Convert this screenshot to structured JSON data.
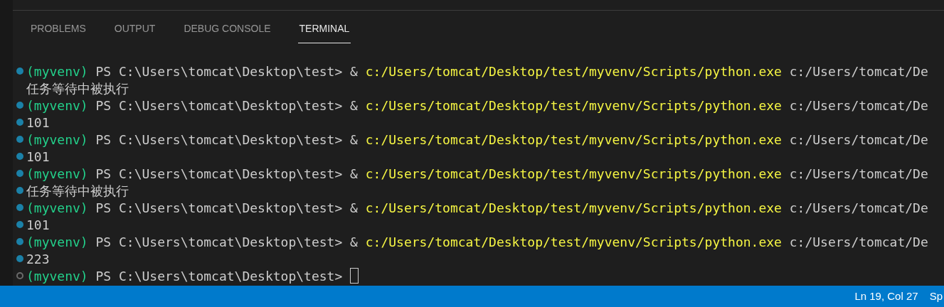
{
  "tabs": [
    {
      "label": "PROBLEMS",
      "selected": false
    },
    {
      "label": "OUTPUT",
      "selected": false
    },
    {
      "label": "DEBUG CONSOLE",
      "selected": false
    },
    {
      "label": "TERMINAL",
      "selected": true
    }
  ],
  "terminal_lines": [
    {
      "kind": "command",
      "decorated": true,
      "completed": true,
      "env": "(myvenv)",
      "prompt": "PS C:\\Users\\tomcat\\Desktop\\test>",
      "operator": "&",
      "program": "c:/Users/tomcat/Desktop/test/myvenv/Scripts/python.exe",
      "argument": "c:/Users/tomcat/De"
    },
    {
      "kind": "output",
      "decorated": false,
      "text": "任务等待中被执行"
    },
    {
      "kind": "command",
      "decorated": true,
      "completed": true,
      "env": "(myvenv)",
      "prompt": "PS C:\\Users\\tomcat\\Desktop\\test>",
      "operator": "&",
      "program": "c:/Users/tomcat/Desktop/test/myvenv/Scripts/python.exe",
      "argument": "c:/Users/tomcat/De"
    },
    {
      "kind": "output",
      "decorated": true,
      "completed": true,
      "text": "101"
    },
    {
      "kind": "command",
      "decorated": true,
      "completed": true,
      "env": "(myvenv)",
      "prompt": "PS C:\\Users\\tomcat\\Desktop\\test>",
      "operator": "&",
      "program": "c:/Users/tomcat/Desktop/test/myvenv/Scripts/python.exe",
      "argument": "c:/Users/tomcat/De"
    },
    {
      "kind": "output",
      "decorated": true,
      "completed": true,
      "text": "101"
    },
    {
      "kind": "command",
      "decorated": true,
      "completed": true,
      "env": "(myvenv)",
      "prompt": "PS C:\\Users\\tomcat\\Desktop\\test>",
      "operator": "&",
      "program": "c:/Users/tomcat/Desktop/test/myvenv/Scripts/python.exe",
      "argument": "c:/Users/tomcat/De"
    },
    {
      "kind": "output",
      "decorated": true,
      "completed": true,
      "text": "任务等待中被执行"
    },
    {
      "kind": "command",
      "decorated": true,
      "completed": true,
      "env": "(myvenv)",
      "prompt": "PS C:\\Users\\tomcat\\Desktop\\test>",
      "operator": "&",
      "program": "c:/Users/tomcat/Desktop/test/myvenv/Scripts/python.exe",
      "argument": "c:/Users/tomcat/De"
    },
    {
      "kind": "output",
      "decorated": true,
      "completed": true,
      "text": "101"
    },
    {
      "kind": "command",
      "decorated": true,
      "completed": true,
      "env": "(myvenv)",
      "prompt": "PS C:\\Users\\tomcat\\Desktop\\test>",
      "operator": "&",
      "program": "c:/Users/tomcat/Desktop/test/myvenv/Scripts/python.exe",
      "argument": "c:/Users/tomcat/De"
    },
    {
      "kind": "output",
      "decorated": true,
      "completed": true,
      "text": "223"
    },
    {
      "kind": "prompt",
      "decorated": true,
      "completed": false,
      "env": "(myvenv)",
      "prompt": "PS C:\\Users\\tomcat\\Desktop\\test>"
    }
  ],
  "status_bar": {
    "items": [
      "Ln 19, Col 27",
      "Sp"
    ]
  }
}
